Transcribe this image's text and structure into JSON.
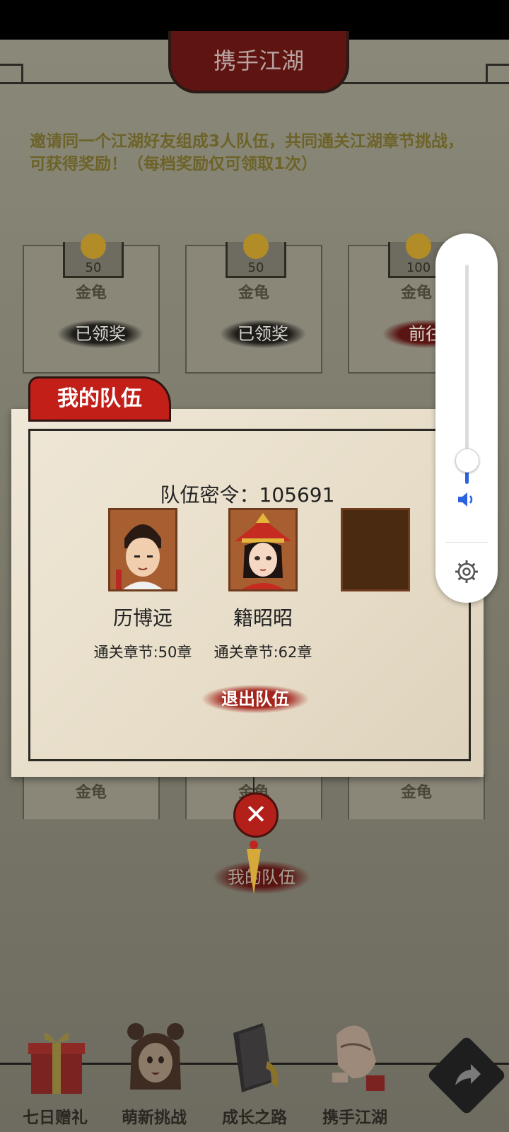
{
  "header": {
    "title": "携手江湖"
  },
  "intro": {
    "line1": "邀请同一个江湖好友组成3人队伍，共同通关江湖章节挑战，",
    "line2": "可获得奖励！（每档奖励仅可领取1次）"
  },
  "rewards": [
    {
      "amount": "50",
      "name": "金龟",
      "button": "已领奖"
    },
    {
      "amount": "50",
      "name": "金龟",
      "button": "已领奖"
    },
    {
      "amount": "100",
      "name": "金龟",
      "button": "前往"
    }
  ],
  "rewards_row2": [
    {
      "name": "金龟"
    },
    {
      "name": "金龟"
    },
    {
      "name": "金龟"
    }
  ],
  "my_team_button": "我的队伍",
  "modal": {
    "tab": "我的队伍",
    "team_code": "队伍密令：105691",
    "members": [
      {
        "name": "历博远",
        "chapters": "通关章节:50章"
      },
      {
        "name": "籍昭昭",
        "chapters": "通关章节:62章"
      }
    ],
    "leave_button": "退出队伍"
  },
  "volume": {
    "level_fraction": 0.1,
    "speaker_icon": "speaker-icon",
    "settings_icon": "gear-icon",
    "accent": "#2a62e0"
  },
  "bottom_nav": [
    {
      "label": "七日赠礼",
      "icon": "gift-box-icon"
    },
    {
      "label": "萌新挑战",
      "icon": "girl-avatar-icon"
    },
    {
      "label": "成长之路",
      "icon": "book-icon"
    },
    {
      "label": "携手江湖",
      "icon": "handshake-icon"
    }
  ],
  "colors": {
    "accent_red": "#c21f19",
    "paper": "#efe7d7",
    "dark": "#2c2a24"
  }
}
